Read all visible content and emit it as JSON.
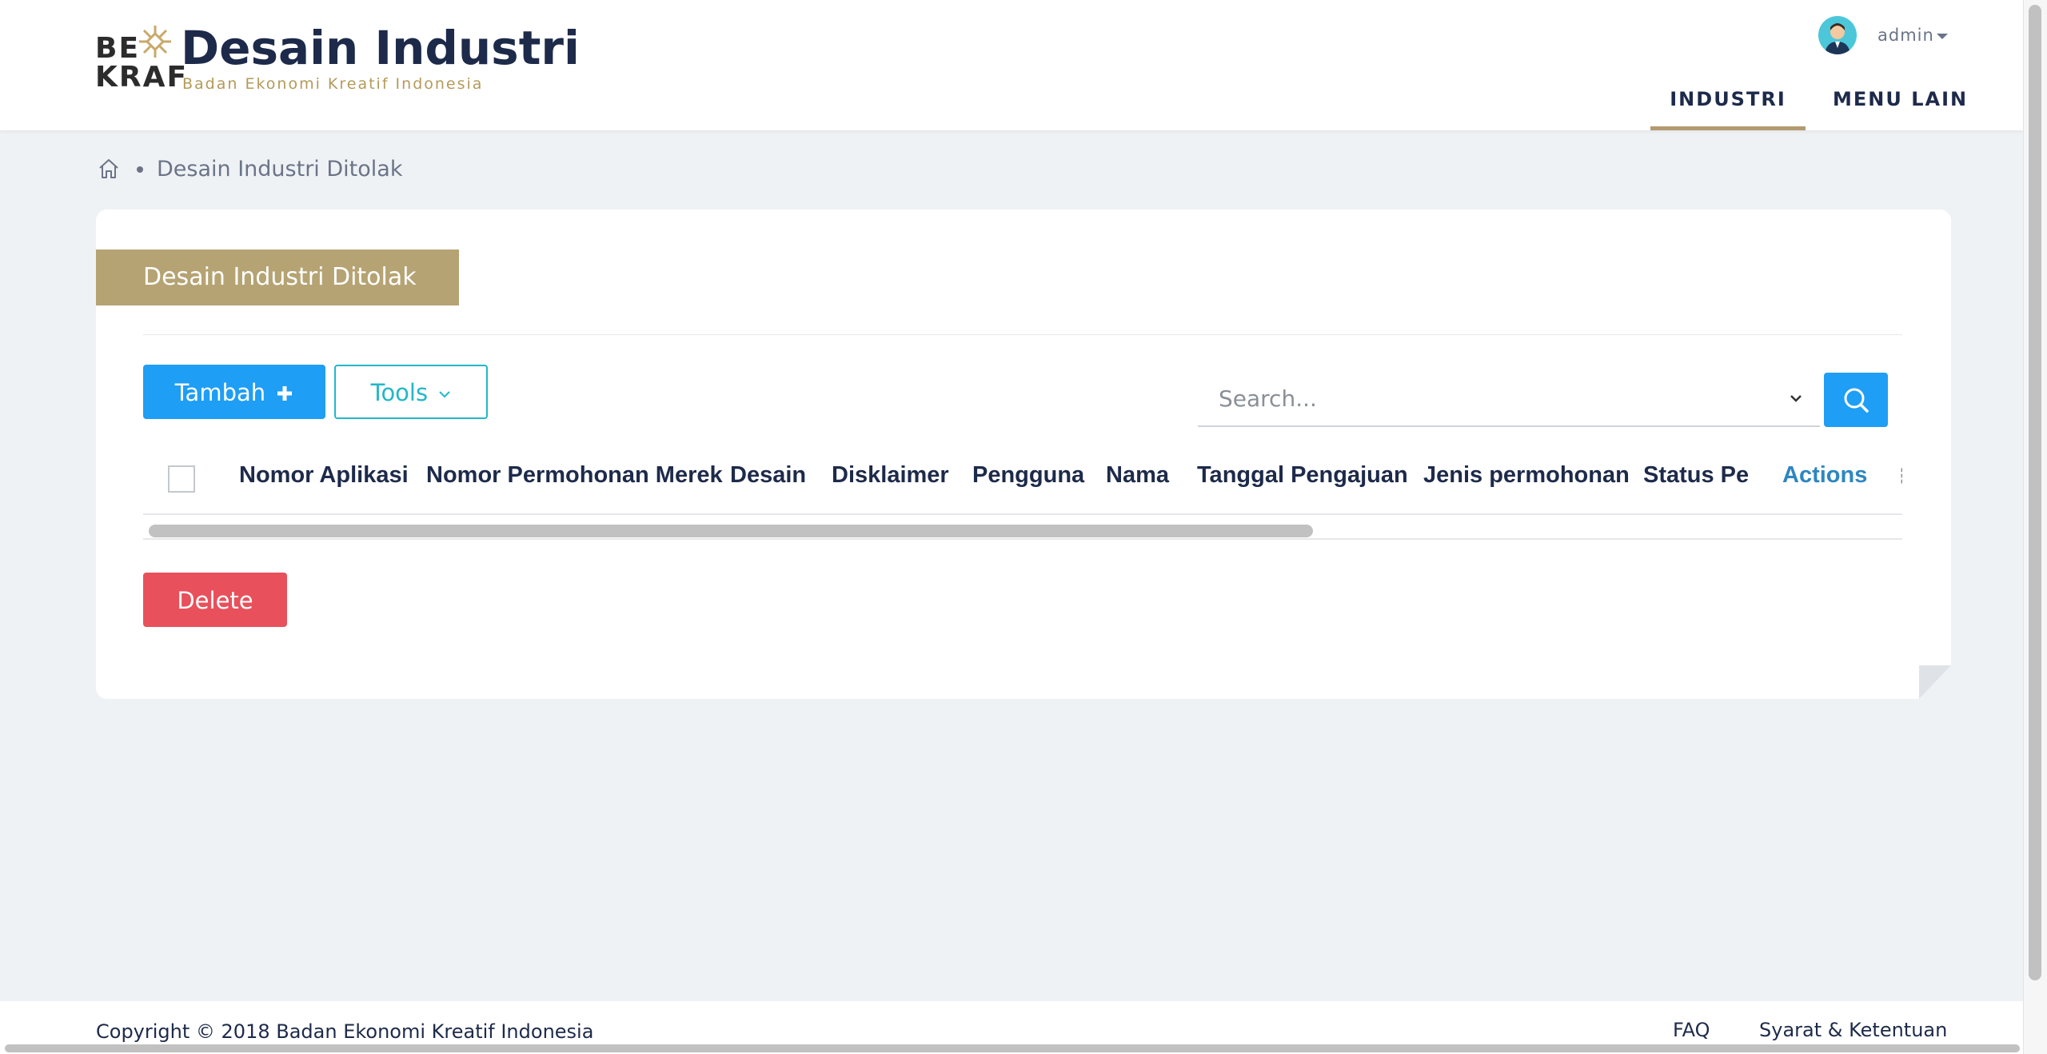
{
  "header": {
    "logo_line1": "BE",
    "logo_line2": "KRAF",
    "app_title": "Desain Industri",
    "app_subtitle": "Badan Ekonomi Kreatif Indonesia",
    "user": {
      "name": "admin",
      "avatar_icon": "avatar-icon"
    },
    "nav": [
      {
        "label": "INDUSTRI",
        "active": true
      },
      {
        "label": "MENU LAIN",
        "active": false
      }
    ]
  },
  "breadcrumb": {
    "home_icon": "home-icon",
    "current": "Desain Industri Ditolak"
  },
  "card": {
    "title": "Desain Industri Ditolak",
    "toolbar": {
      "add_label": "Tambah",
      "add_icon": "plus-icon",
      "tools_label": "Tools",
      "tools_icon": "chevron-down-icon"
    },
    "search": {
      "placeholder": "Search...",
      "button_icon": "search-icon"
    },
    "table": {
      "columns": [
        "Nomor Aplikasi",
        "Nomor Permohonan Merek",
        "Desain",
        "Disklaimer",
        "Pengguna",
        "Nama",
        "Tanggal Pengajuan",
        "Jenis permohonan",
        "Status Pe",
        "Actions"
      ]
    },
    "delete_label": "Delete"
  },
  "footer": {
    "copyright": "Copyright © 2018 Badan Ekonomi Kreatif Indonesia",
    "links": [
      "FAQ",
      "Syarat & Ketentuan"
    ]
  },
  "colors": {
    "primary": "#1e9ef5",
    "tools": "#22b7c9",
    "danger": "#e8505b",
    "ribbon": "#b5a373",
    "nav_underline": "#b49a70",
    "text_dark": "#1d2a4a",
    "page_bg": "#eff2f5"
  }
}
